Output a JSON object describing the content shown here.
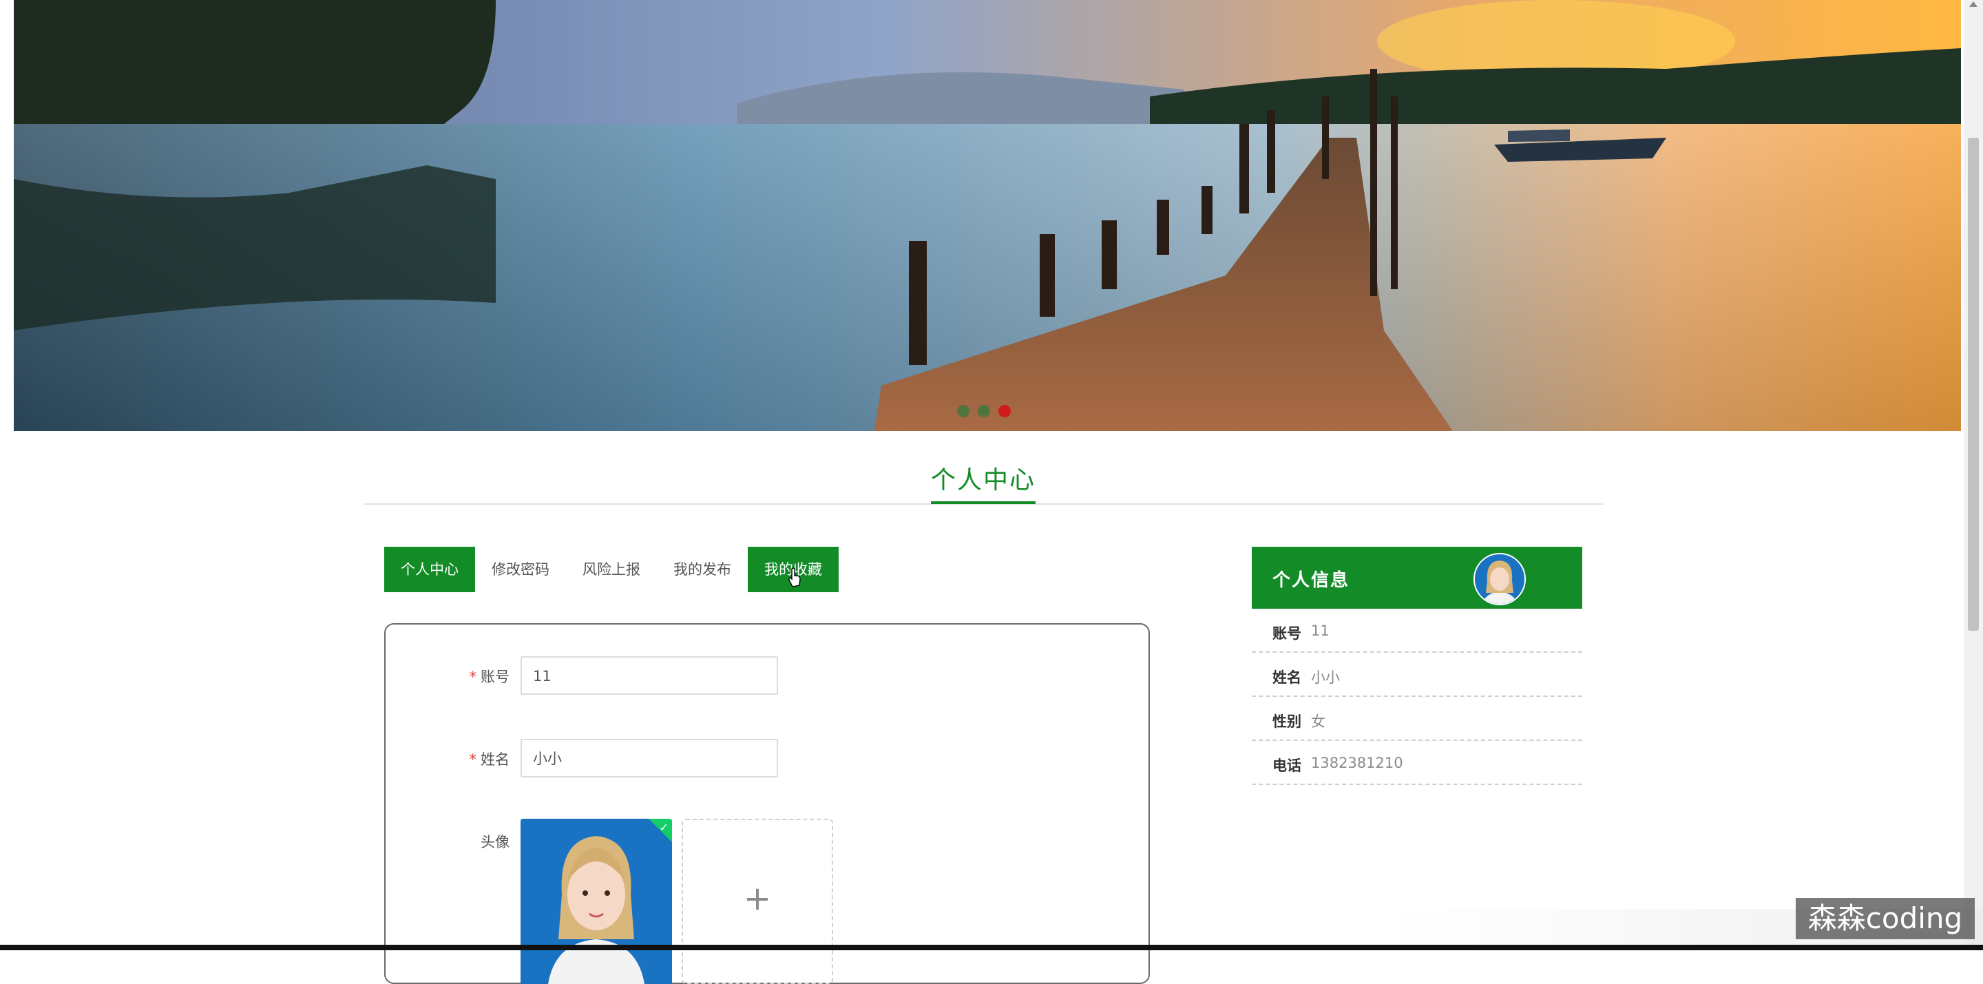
{
  "banner": {
    "slides": 3,
    "active_slide": 3
  },
  "section": {
    "title": "个人中心"
  },
  "tabs": [
    {
      "label": "个人中心"
    },
    {
      "label": "修改密码"
    },
    {
      "label": "风险上报"
    },
    {
      "label": "我的发布"
    },
    {
      "label": "我的收藏"
    }
  ],
  "form": {
    "account_label": "账号",
    "account_value": "11",
    "name_label": "姓名",
    "name_value": "小小",
    "avatar_label": "头像",
    "required_mark": "*",
    "upload_plus": "+"
  },
  "info": {
    "title": "个人信息",
    "rows": [
      {
        "key": "账号",
        "value": "11"
      },
      {
        "key": "姓名",
        "value": "小小"
      },
      {
        "key": "性别",
        "value": "女"
      },
      {
        "key": "电话",
        "value": "1382381210"
      }
    ]
  },
  "watermark": "森森coding",
  "colors": {
    "primary": "#138c28",
    "required": "#e53a3a",
    "upload_check": "#13ce66"
  }
}
